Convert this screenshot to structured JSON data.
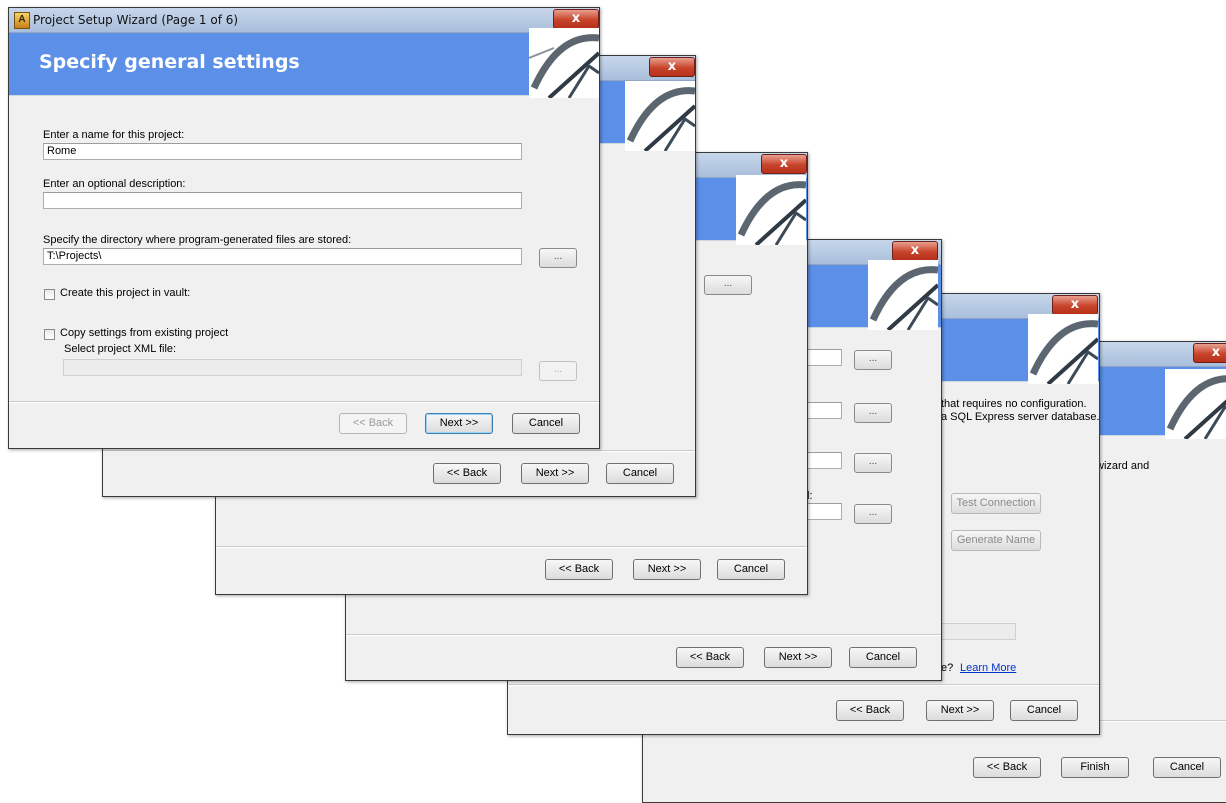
{
  "dialog": {
    "title": "Project Setup Wizard (Page 1 of 6)",
    "app_icon_letter": "A",
    "close_glyph": "x",
    "heading": "Specify general settings",
    "project_name_label": "Enter a name for this project:",
    "project_name_value": "Rome",
    "description_label": "Enter an optional description:",
    "description_value": "",
    "directory_label": "Specify the directory where program-generated files are stored:",
    "directory_value": "T:\\Projects\\",
    "browse_label": "...",
    "vault_checkbox_label": "Create this project in vault:",
    "copy_settings_label": "Copy settings from existing project",
    "xml_file_label": "Select project XML file:",
    "xml_file_value": "",
    "back_label": "<< Back",
    "next_label": "Next >>",
    "cancel_label": "Cancel"
  },
  "background_pages": {
    "page2": {
      "back": "<< Back",
      "next": "Next >>",
      "cancel": "Cancel",
      "browse": "..."
    },
    "page3": {
      "back": "<< Back",
      "next": "Next >>",
      "cancel": "Cancel"
    },
    "page4": {
      "back": "<< Back",
      "next": "Next >>",
      "cancel": "Cancel",
      "browse": "...",
      "colon_fragment": "l:"
    },
    "page5": {
      "info_line1": "that requires no configuration.",
      "info_line2": "a SQL Express server database.",
      "test_connection": "Test Connection",
      "generate_name": "Generate Name",
      "question_fragment": "e?",
      "learn_more": "Learn More",
      "back": "<< Back",
      "next": "Next >>",
      "cancel": "Cancel"
    },
    "page6": {
      "text_fragment": "wizard and",
      "back": "<< Back",
      "finish": "Finish",
      "cancel": "Cancel"
    }
  },
  "colors": {
    "banner": "#5b8fe8",
    "close_button": "#c8432b",
    "window_bg": "#f0f0f0"
  }
}
